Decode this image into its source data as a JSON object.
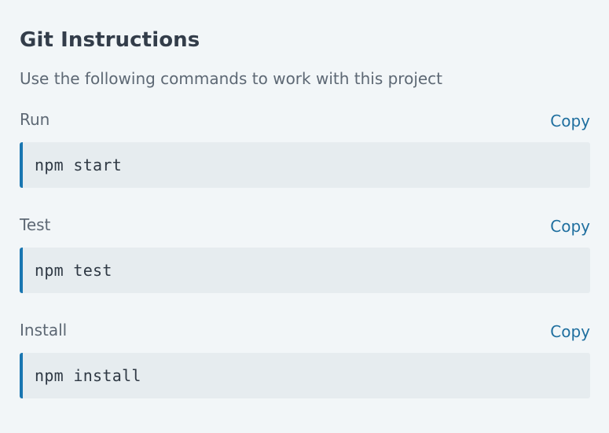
{
  "header": {
    "title": "Git Instructions",
    "subtitle": "Use the following commands to work with this project"
  },
  "commands": [
    {
      "label": "Run",
      "copy_label": "Copy",
      "code": "npm start"
    },
    {
      "label": "Test",
      "copy_label": "Copy",
      "code": "npm test"
    },
    {
      "label": "Install",
      "copy_label": "Copy",
      "code": "npm install"
    }
  ],
  "colors": {
    "background": "#f2f6f8",
    "code_background": "#e6ecef",
    "accent": "#1976b1",
    "link": "#1f6f9f",
    "title": "#333d4a",
    "muted_text": "#5d6874"
  }
}
